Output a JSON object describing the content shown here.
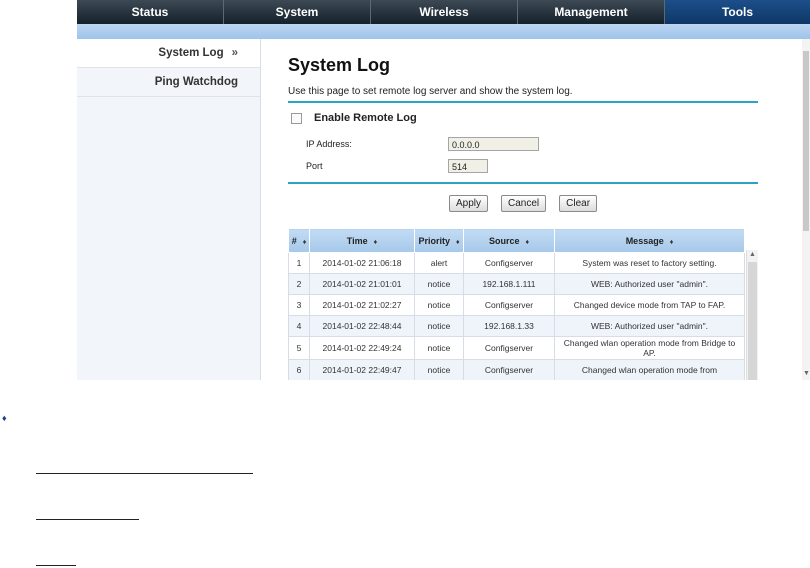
{
  "nav": {
    "tabs": [
      "Status",
      "System",
      "Wireless",
      "Management",
      "Tools"
    ]
  },
  "sidebar": {
    "items": [
      {
        "label": "System Log",
        "arrow": "»"
      },
      {
        "label": "Ping Watchdog",
        "arrow": ""
      }
    ]
  },
  "page": {
    "title": "System Log",
    "description": "Use this page to set remote log server and show the system log."
  },
  "form": {
    "remote_label": "Enable Remote Log",
    "ip_label": "IP Address:",
    "ip_value": "0.0.0.0",
    "port_label": "Port",
    "port_value": "514"
  },
  "buttons": {
    "apply": "Apply",
    "cancel": "Cancel",
    "clear": "Clear"
  },
  "table": {
    "headers": [
      "#",
      "Time",
      "Priority",
      "Source",
      "Message"
    ],
    "sort_glyph": "♦",
    "rows": [
      [
        "1",
        "2014-01-02 21:06:18",
        "alert",
        "Configserver",
        "System was reset to factory setting."
      ],
      [
        "2",
        "2014-01-02 21:01:01",
        "notice",
        "192.168.1.111",
        "WEB: Authorized user \"admin\"."
      ],
      [
        "3",
        "2014-01-02 21:02:27",
        "notice",
        "Configserver",
        "Changed device mode from TAP to FAP."
      ],
      [
        "4",
        "2014-01-02 22:48:44",
        "notice",
        "192.168.1.33",
        "WEB: Authorized user \"admin\"."
      ],
      [
        "5",
        "2014-01-02 22:49:24",
        "notice",
        "Configserver",
        "Changed wlan operation mode from Bridge to AP."
      ],
      [
        "6",
        "2014-01-02 22:49:47",
        "notice",
        "Configserver",
        "Changed wlan operation mode from"
      ]
    ]
  },
  "bullet_glyph": "♦",
  "scroll": {
    "up": "▲",
    "down": "▼"
  }
}
